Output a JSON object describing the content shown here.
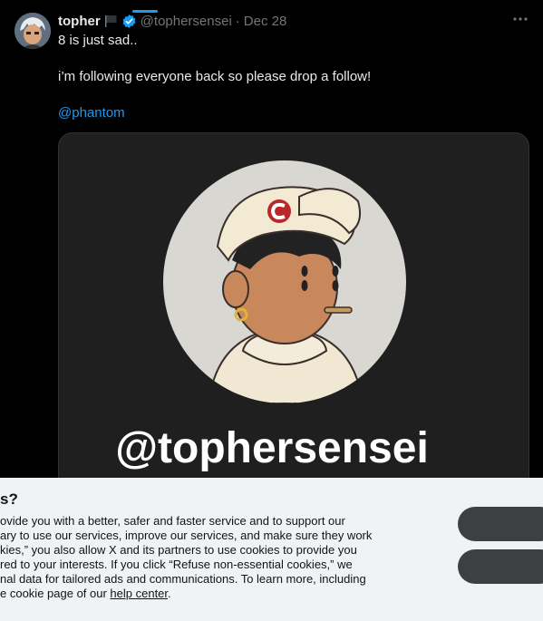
{
  "tweet": {
    "author_name": "topher",
    "author_handle": "@tophersensei",
    "date": "Dec 28",
    "separator": "·",
    "lines": [
      "8 is just sad..",
      "i’m following everyone back so please drop a follow!"
    ],
    "mention": "@phantom",
    "card_handle": "@tophersensei"
  },
  "cookie_banner": {
    "title": "s?",
    "body_lines": [
      "ovide you with a better, safer and faster service and to support our",
      "ary to use our services, improve our services, and make sure they work",
      "kies,” you also allow X and its partners to use cookies to provide you",
      "red to your interests. If you click “Refuse non-essential cookies,” we",
      "nal data for tailored ads and communications. To learn more, including",
      "e cookie page of our "
    ],
    "link_text": "help center",
    "link_suffix": "."
  },
  "colors": {
    "accent": "#1d9bf0",
    "background": "#000000",
    "muted": "#71767b",
    "banner": "#eff3f4"
  }
}
